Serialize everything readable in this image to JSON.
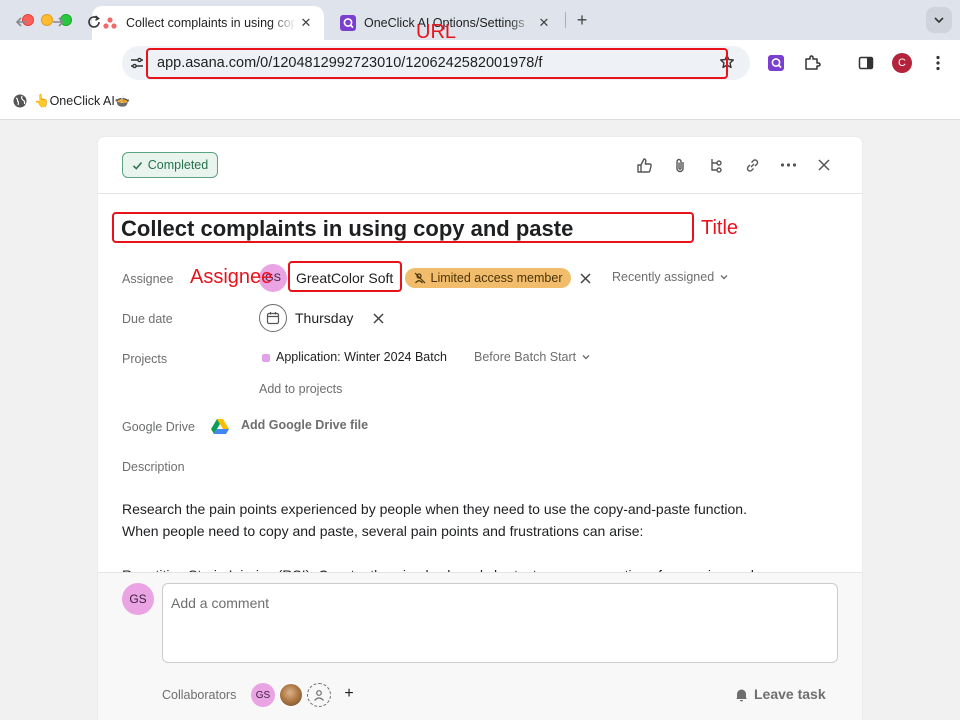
{
  "browser": {
    "tabs": [
      {
        "title": "Collect complaints in using copy and paste",
        "active": true
      },
      {
        "title": "OneClick AI Options/Settings",
        "active": false
      }
    ],
    "url": "app.asana.com/0/1204812992723010/1206242582001978/f",
    "bookmarks": [
      {
        "label": "👆OneClick AI🍲"
      }
    ],
    "profile_initial": "C",
    "new_tab_label": "+"
  },
  "task": {
    "status_label": "Completed",
    "title": "Collect complaints in using copy and paste",
    "fields": {
      "assignee_label": "Assignee",
      "due_date_label": "Due date",
      "projects_label": "Projects",
      "google_drive_label": "Google Drive",
      "description_label": "Description"
    },
    "assignee": {
      "initials": "GS",
      "name": "GreatColor Soft",
      "badge": "Limited access member",
      "recently_assigned": "Recently assigned"
    },
    "due_date": "Thursday",
    "project": {
      "name": "Application: Winter 2024 Batch",
      "section": "Before Batch Start",
      "add_label": "Add to projects"
    },
    "google_drive_add": "Add Google Drive file",
    "description": {
      "line1": "Research the pain points experienced by people when they need to use the copy-and-paste function.",
      "line2": "When people need to copy and paste, several pain points and frustrations can arise:",
      "line3": "Repetitive Strain Injuries (RSI): Constantly using keyboard shortcuts or mouse actions for copying and"
    }
  },
  "comment": {
    "avatar_initials": "GS",
    "placeholder": "Add a comment",
    "collaborators_label": "Collaborators",
    "collaborator_initials": "GS",
    "add_label": "+",
    "leave_task": "Leave task"
  },
  "annotations": {
    "url": "URL",
    "title": "Title",
    "assignee": "Assignee",
    "color": "#e8121b"
  },
  "colors": {
    "completed_green": "#26734d",
    "limited_badge": "#f1bd6c",
    "avatar_pink": "#eaa4e3",
    "annotation_red": "#e8121b"
  }
}
